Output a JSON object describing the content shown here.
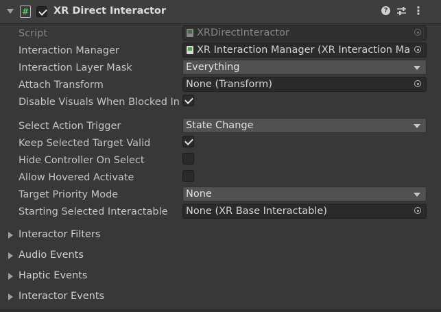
{
  "header": {
    "title": "XR Direct Interactor",
    "enabled": true,
    "script_icon_glyph": "#",
    "help_glyph": "?",
    "menu_glyph": "⋮",
    "icons": [
      "script-icon",
      "help-icon",
      "presets-icon",
      "kebab-menu-icon"
    ]
  },
  "fields": {
    "script": {
      "label": "Script",
      "value": "XRDirectInteractor"
    },
    "interaction_manager": {
      "label": "Interaction Manager",
      "value": "XR Interaction Manager (XR Interaction Manager)"
    },
    "interaction_layer_mask": {
      "label": "Interaction Layer Mask",
      "value": "Everything"
    },
    "attach_transform": {
      "label": "Attach Transform",
      "value": "None (Transform)"
    },
    "disable_visuals": {
      "label": "Disable Visuals When Blocked In",
      "checked": true
    },
    "select_action_trigger": {
      "label": "Select Action Trigger",
      "value": "State Change"
    },
    "keep_selected_target_valid": {
      "label": "Keep Selected Target Valid",
      "checked": true
    },
    "hide_controller_on_select": {
      "label": "Hide Controller On Select",
      "checked": false
    },
    "allow_hovered_activate": {
      "label": "Allow Hovered Activate",
      "checked": false
    },
    "target_priority_mode": {
      "label": "Target Priority Mode",
      "value": "None"
    },
    "starting_selected_interactable": {
      "label": "Starting Selected Interactable",
      "value": "None (XR Base Interactable)"
    }
  },
  "sections": {
    "interactor_filters": "Interactor Filters",
    "audio_events": "Audio Events",
    "haptic_events": "Haptic Events",
    "interactor_events": "Interactor Events"
  }
}
